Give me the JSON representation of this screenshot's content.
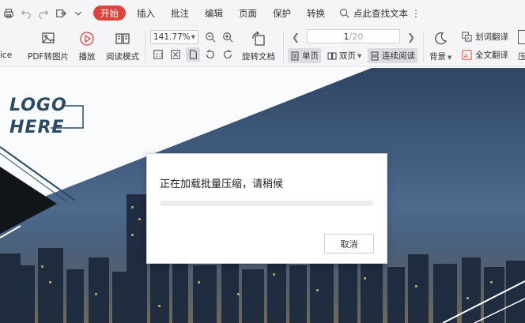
{
  "menubar": {
    "tabs": [
      {
        "label": "开始",
        "active": true
      },
      {
        "label": "插入"
      },
      {
        "label": "批注"
      },
      {
        "label": "编辑"
      },
      {
        "label": "页面"
      },
      {
        "label": "保护"
      },
      {
        "label": "转换"
      }
    ],
    "search_label": "点此查找文本",
    "accent_color": "#e0433b"
  },
  "toolbar": {
    "cut_left_label": "ice",
    "pdf_to_image": "PDF转图片",
    "play": "播放",
    "reading_mode": "阅读模式",
    "zoom": "141.77%",
    "rotate_doc": "旋转文档",
    "page_current": "1",
    "page_total": "/20",
    "single_page": "单页",
    "double_page": "双页",
    "continuous": "连续阅读",
    "background": "背景",
    "word_translate": "划词翻译",
    "full_translate": "全文翻译",
    "cut_right_label": "压"
  },
  "document": {
    "logo_line1": "LOGO",
    "logo_line2": "HERE"
  },
  "dialog": {
    "message": "正在加载批量压缩，请稍候",
    "progress": 0.0,
    "cancel_label": "取消"
  }
}
